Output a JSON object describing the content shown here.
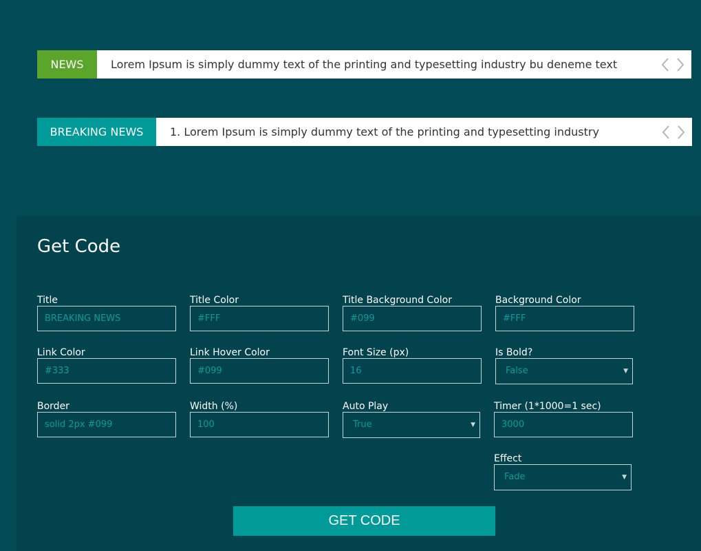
{
  "ticker_news": {
    "title": "NEWS",
    "text": "Lorem Ipsum is simply dummy text of the printing and typesetting industry bu deneme text",
    "title_bg": "#5aa52a"
  },
  "ticker_breaking": {
    "title": "BREAKING NEWS",
    "text": "1. Lorem Ipsum is simply dummy text of the printing and typesetting industry",
    "title_bg": "#009a99"
  },
  "panel": {
    "heading": "Get Code",
    "fields": {
      "title": {
        "label": "Title",
        "value": "BREAKING NEWS"
      },
      "title_color": {
        "label": "Title Color",
        "value": "#FFF"
      },
      "title_bg_color": {
        "label": "Title Background Color",
        "value": "#099"
      },
      "bg_color": {
        "label": "Background Color",
        "value": "#FFF"
      },
      "link_color": {
        "label": "Link Color",
        "value": "#333"
      },
      "link_hover_color": {
        "label": "Link Hover Color",
        "value": "#099"
      },
      "font_size": {
        "label": "Font Size (px)",
        "value": "16"
      },
      "is_bold": {
        "label": "Is Bold?",
        "value": "False"
      },
      "border": {
        "label": "Border",
        "value": "solid 2px #099"
      },
      "width": {
        "label": "Width (%)",
        "value": "100"
      },
      "auto_play": {
        "label": "Auto Play",
        "value": "True"
      },
      "timer": {
        "label": "Timer (1*1000=1 sec)",
        "value": "3000"
      },
      "effect": {
        "label": "Effect",
        "value": "Fade"
      }
    },
    "button_label": "GET CODE"
  },
  "colors": {
    "page_bg": "#024a56",
    "panel_bg": "#02434d",
    "accent": "#009a99",
    "news_green": "#5aa52a"
  },
  "icons": {
    "prev": "chevron-left-icon",
    "next": "chevron-right-icon",
    "select_caret": "triangle-down-icon"
  }
}
